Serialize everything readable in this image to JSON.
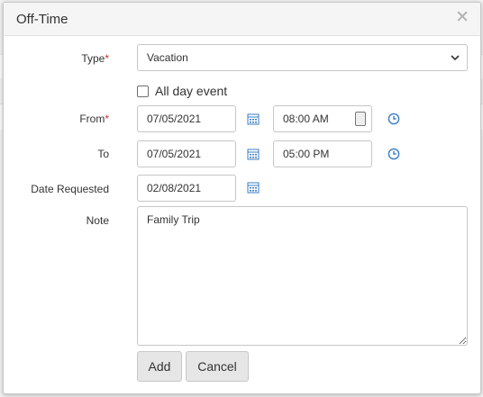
{
  "dialog": {
    "title": "Off-Time",
    "close_icon": "close-icon"
  },
  "form": {
    "type": {
      "label": "Type",
      "value": "Vacation",
      "required_mark": "*"
    },
    "all_day": {
      "label": "All day event",
      "checked": false
    },
    "from": {
      "label": "From",
      "required_mark": "*",
      "date": "07/05/2021",
      "time": "08:00 AM"
    },
    "to": {
      "label": "To",
      "date": "07/05/2021",
      "time": "05:00 PM"
    },
    "date_requested": {
      "label": "Date Requested",
      "date": "02/08/2021"
    },
    "note": {
      "label": "Note",
      "value": "Family Trip"
    }
  },
  "buttons": {
    "add": "Add",
    "cancel": "Cancel"
  },
  "icons": {
    "calendar": "calendar-icon",
    "clock": "clock-icon",
    "dropdown": "chevron-down-icon",
    "accent": "#3a7cc4"
  }
}
